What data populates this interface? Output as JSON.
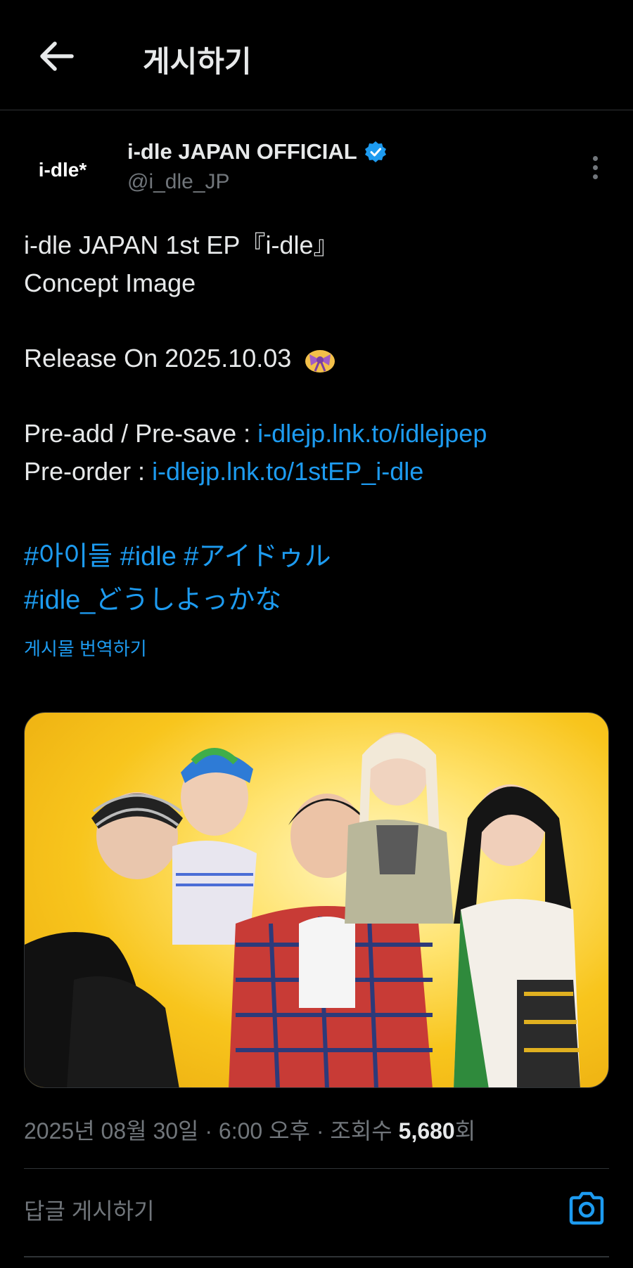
{
  "header": {
    "title": "게시하기",
    "back_icon": "arrow-left-icon"
  },
  "author": {
    "avatar_text": "i-dle*",
    "display_name": "i-dle JAPAN OFFICIAL",
    "handle": "@i_dle_JP",
    "verified_color": "#1d9bf0"
  },
  "tweet": {
    "line1": "i-dle JAPAN 1st EP『i-dle』",
    "line2": "Concept Image",
    "line3": "Release On 2025.10.03",
    "preadd_label": "Pre-add / Pre-save : ",
    "preadd_link": "i-dlejp.lnk.to/idlejpep",
    "preorder_label": "Pre-order : ",
    "preorder_link": "i-dlejp.lnk.to/1stEP_i-dle",
    "hashtags_line1": "#아이들 #idle #アイドゥル",
    "hashtags_line2": "#idle_どうしよっかな",
    "translate": "게시물 번역하기"
  },
  "meta": {
    "date": "2025년 08월 30일",
    "time": "6:00 오후",
    "views_label": "조회수",
    "views_count": "5,680",
    "views_suffix": "회"
  },
  "reply": {
    "placeholder": "답글 게시하기",
    "camera_icon": "camera-icon"
  },
  "colors": {
    "background": "#000000",
    "link": "#1d9bf0",
    "muted": "#71767b",
    "text": "#e7e9ea"
  }
}
